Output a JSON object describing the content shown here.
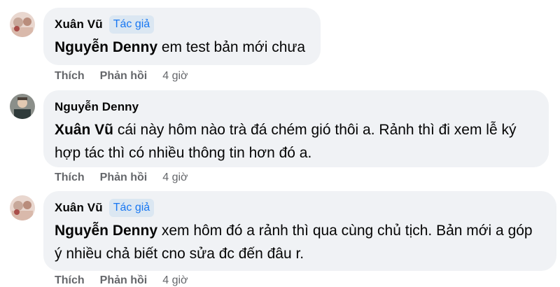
{
  "comments": [
    {
      "author": "Xuân Vũ",
      "badge": "Tác giả",
      "mention": "Nguyễn Denny",
      "text_line1": " em test bản mới chưa",
      "text_line2": "",
      "like_label": "Thích",
      "reply_label": "Phản hồi",
      "time": "4 giờ",
      "avatar_icon": "user-avatar-icon"
    },
    {
      "author": "Nguyễn Denny",
      "badge": "",
      "mention": "Xuân Vũ",
      "text_line1": " cái này hôm nào trà đá chém gió thôi a. Rảnh thì đi xem lễ ký",
      "text_line2": "hợp tác thì có nhiều thông tin hơn đó a.",
      "like_label": "Thích",
      "reply_label": "Phản hồi",
      "time": "4 giờ",
      "avatar_icon": "user-avatar-icon"
    },
    {
      "author": "Xuân Vũ",
      "badge": "Tác giả",
      "mention": "Nguyễn Denny",
      "text_line1": " xem hôm đó a rảnh thì qua cùng chủ tịch. Bản mới a góp",
      "text_line2": "ý nhiều chả biết cno sửa đc đến đâu r.",
      "like_label": "Thích",
      "reply_label": "Phản hồi",
      "time": "4 giờ",
      "avatar_icon": "user-avatar-icon"
    }
  ],
  "colors": {
    "bubble_bg": "#f0f2f5",
    "badge_bg": "#dbe7f2",
    "badge_text": "#1877f2",
    "action_text": "#65676b"
  }
}
